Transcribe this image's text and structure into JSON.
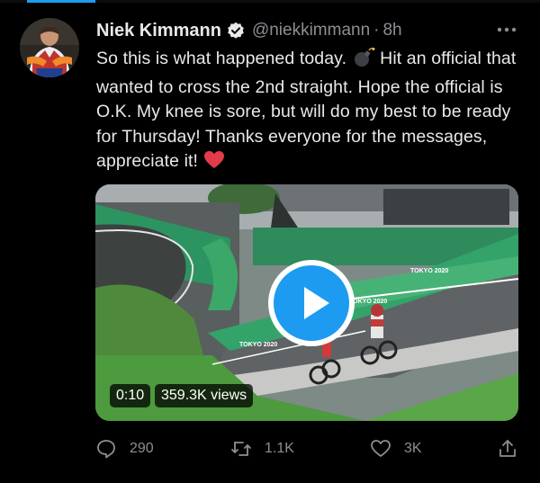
{
  "author": {
    "name": "Niek Kimmann",
    "handle": "@niekkimmann",
    "separator": "·",
    "time": "8h"
  },
  "tweet": {
    "text_part1": "So this is what happened today.",
    "text_part2": "Hit an official that wanted to cross the 2nd straight. Hope the official is O.K. My knee is sore, but will do my best to be ready for Thursday! Thanks everyone for the messages, appreciate it!",
    "emoji_1": "bomb-emoji",
    "emoji_2": "red-heart-emoji"
  },
  "media": {
    "duration": "0:10",
    "views": "359.3K views",
    "banner_text": "TOKYO 2020"
  },
  "actions": {
    "replies": "290",
    "retweets": "1.1K",
    "likes": "3K"
  },
  "colors": {
    "background": "#000000",
    "text": "#e7e9ea",
    "muted": "#8b8f94",
    "accent": "#1d9bf0",
    "heart": "#f91880"
  }
}
